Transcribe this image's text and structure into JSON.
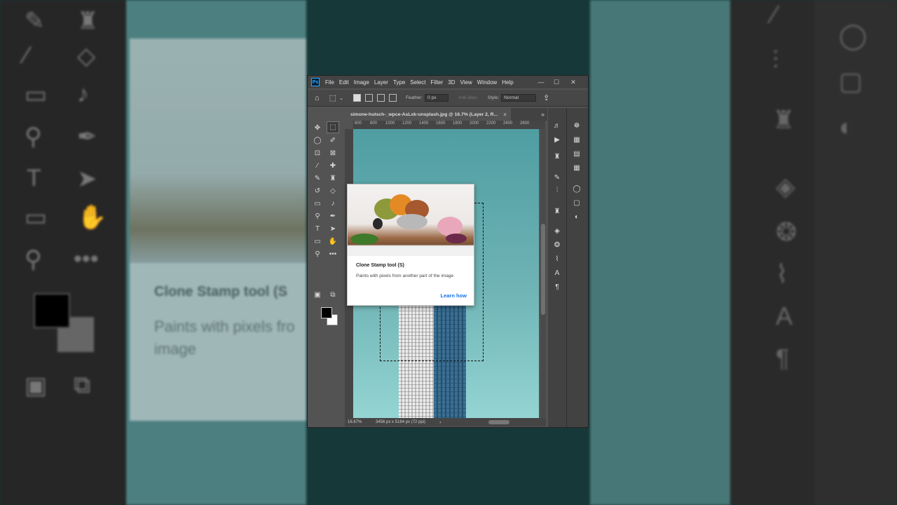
{
  "app": {
    "logo": "Ps",
    "menu": [
      "File",
      "Edit",
      "Image",
      "Layer",
      "Type",
      "Select",
      "Filter",
      "3D",
      "View",
      "Window",
      "Help"
    ],
    "window_controls": {
      "minimize": "—",
      "maximize": "☐",
      "close": "✕"
    }
  },
  "options": {
    "feather_label": "Feather:",
    "feather_value": "0 px",
    "antialias_label": "Anti-alias",
    "style_label": "Style:",
    "style_value": "Normal"
  },
  "document": {
    "tab_title": "simone-hutsch-_wpce-AsLxk-unsplash.jpg @ 16.7% (Layer 2, R...",
    "tab_close": "×",
    "panel_collapse": "»",
    "ruler_ticks": [
      "600",
      "800",
      "1000",
      "1200",
      "1400",
      "1600",
      "1800",
      "2000",
      "2200",
      "2400",
      "2600"
    ]
  },
  "status": {
    "zoom": "16.67%",
    "doc_info": "3456 px x 5184 px (72 ppi)",
    "arrow": "›"
  },
  "tooltip": {
    "title": "Clone Stamp tool (S)",
    "description": "Paints with pixels from another part of the image",
    "link": "Learn how"
  },
  "background_zoom": {
    "title": "Clone Stamp tool (S",
    "description": "Paints with pixels fro image"
  },
  "colors": {
    "foreground": "#000000",
    "background": "#ffffff",
    "link": "#1473e6",
    "canvas_sky": "#6fb3b5"
  }
}
